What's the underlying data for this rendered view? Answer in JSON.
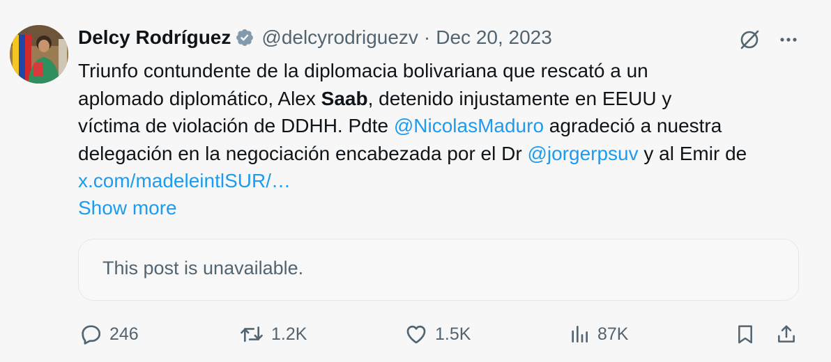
{
  "post": {
    "author": {
      "name": "Delcy Rodríguez",
      "handle": "@delcyrodriguezv",
      "separator": "·",
      "date": "Dec 20, 2023",
      "verified_color": "#829aab"
    },
    "text_lines": {
      "l1": "Triunfo contundente de la diplomacia bolivariana que rescató a un",
      "l2_a": "aplomado diplomático, Alex ",
      "l2_b": "Saab",
      "l2_c": ", detenido injustamente en EEUU y",
      "l3_a": "víctima de violación de DDHH. Pdte ",
      "l3_mention": "@NicolasMaduro",
      "l3_c": " agradeció a nuestra",
      "l4_a": "delegación en la negociación encabezada por el Dr ",
      "l4_mention": "@jorgerpsuv",
      "l4_c": " y al Emir de",
      "l5_link": "x.com/madeleintlSUR/…"
    },
    "show_more": "Show more",
    "quote": {
      "text": "This post is unavailable."
    },
    "actions": {
      "replies": "246",
      "reposts": "1.2K",
      "likes": "1.5K",
      "views": "87K"
    },
    "icons": {
      "grok": "grok-icon",
      "more": "more-icon",
      "reply": "reply-icon",
      "repost": "repost-icon",
      "like": "heart-icon",
      "views": "views-icon",
      "bookmark": "bookmark-icon",
      "share": "share-icon"
    },
    "colors": {
      "link": "#1d9bf0",
      "secondary_text": "#536471",
      "background": "#f7f7f7"
    }
  }
}
